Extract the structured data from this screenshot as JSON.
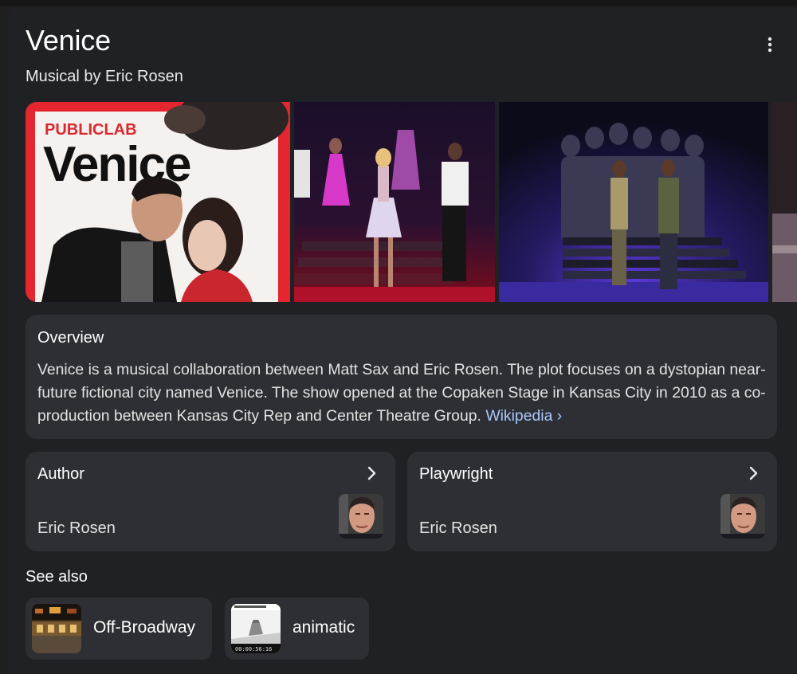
{
  "title": "Venice",
  "subtitle": "Musical by Eric Rosen",
  "more_icon": "more-vertical-icon",
  "poster": {
    "logo": "PUBLICLAB",
    "title": "Venice"
  },
  "overview": {
    "heading": "Overview",
    "text": "Venice is a musical collaboration between Matt Sax and Eric Rosen. The plot focuses on a dystopian near-future fictional city named Venice. The show opened at the Copaken Stage in Kansas City in 2010 as a co-production between Kansas City Rep and Center Theatre Group.",
    "source_link": "Wikipedia ›"
  },
  "cards": [
    {
      "label": "Author",
      "value": "Eric Rosen",
      "icon": "chevron-right-icon"
    },
    {
      "label": "Playwright",
      "value": "Eric Rosen",
      "icon": "chevron-right-icon"
    }
  ],
  "see_also": {
    "heading": "See also",
    "items": [
      {
        "label": "Off-Broadway"
      },
      {
        "label": "animatic",
        "thumb_timestamp": "00:00:56:16"
      }
    ]
  },
  "colors": {
    "background": "#202124",
    "card": "#2d2f35",
    "link": "#a8c7fa",
    "poster_red": "#e3262f"
  }
}
